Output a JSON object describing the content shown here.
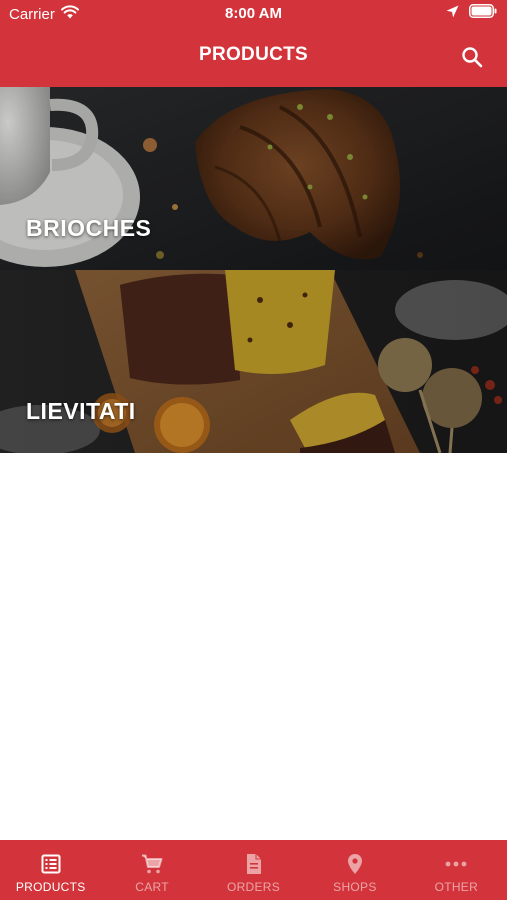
{
  "status_bar": {
    "carrier": "Carrier",
    "time": "8:00 AM"
  },
  "nav": {
    "title": "PRODUCTS"
  },
  "categories": [
    {
      "label": "BRIOCHES"
    },
    {
      "label": "LIEVITATI"
    }
  ],
  "tabs": [
    {
      "label": "PRODUCTS",
      "icon": "list-icon",
      "active": true
    },
    {
      "label": "CART",
      "icon": "cart-icon",
      "active": false
    },
    {
      "label": "ORDERS",
      "icon": "document-icon",
      "active": false
    },
    {
      "label": "SHOPS",
      "icon": "map-pin-icon",
      "active": false
    },
    {
      "label": "OTHER",
      "icon": "more-icon",
      "active": false
    }
  ],
  "colors": {
    "brand": "#d3343b",
    "tab_inactive": "rgba(255,255,255,0.55)",
    "tab_active": "#ffffff"
  }
}
